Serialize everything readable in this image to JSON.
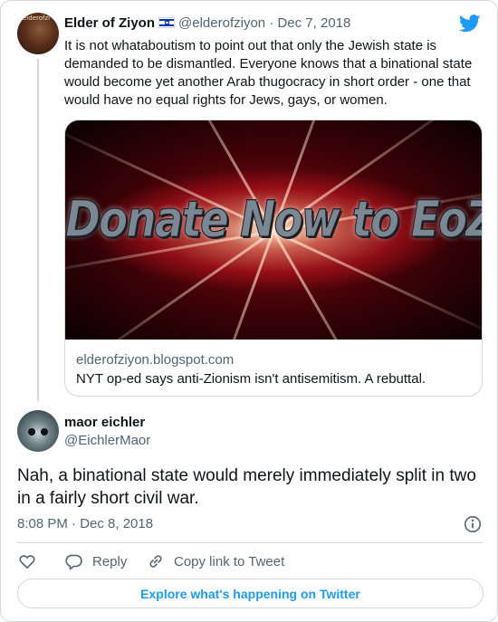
{
  "original_tweet": {
    "author_name": "Elder of Ziyon",
    "author_flag_icon": "israel-flag-icon",
    "avatar_tag": "elderofzi",
    "handle": "@elderofziyon",
    "date": "Dec 7, 2018",
    "text": "It is not whataboutism to point out that only the Jewish state is demanded to be dismantled. Everyone knows that a binational state would become yet another Arab thugocracy in short order - one that would have no equal rights for Jews, gays, or women.",
    "link_card": {
      "image_headline": "Donate Now to EoZ",
      "domain": "elderofziyon.blogspot.com",
      "title": "NYT op-ed says anti-Zionism isn't antisemitism. A rebuttal."
    }
  },
  "reply_tweet": {
    "author_name": "maor eichler",
    "handle": "@EichlerMaor",
    "text": "Nah, a binational state would merely immediately split in two in a fairly short civil war.",
    "timestamp": "8:08 PM · Dec 8, 2018"
  },
  "actions": {
    "like_label": "",
    "reply_label": "Reply",
    "copy_link_label": "Copy link to Tweet"
  },
  "footer": {
    "explore_label": "Explore what's happening on Twitter"
  },
  "colors": {
    "brand": "#1d9bf0",
    "text_primary": "#0f1419",
    "text_secondary": "#536471",
    "border": "#cfd9de"
  },
  "icons": [
    "twitter-logo-icon",
    "info-icon",
    "heart-icon",
    "reply-icon",
    "link-icon"
  ]
}
